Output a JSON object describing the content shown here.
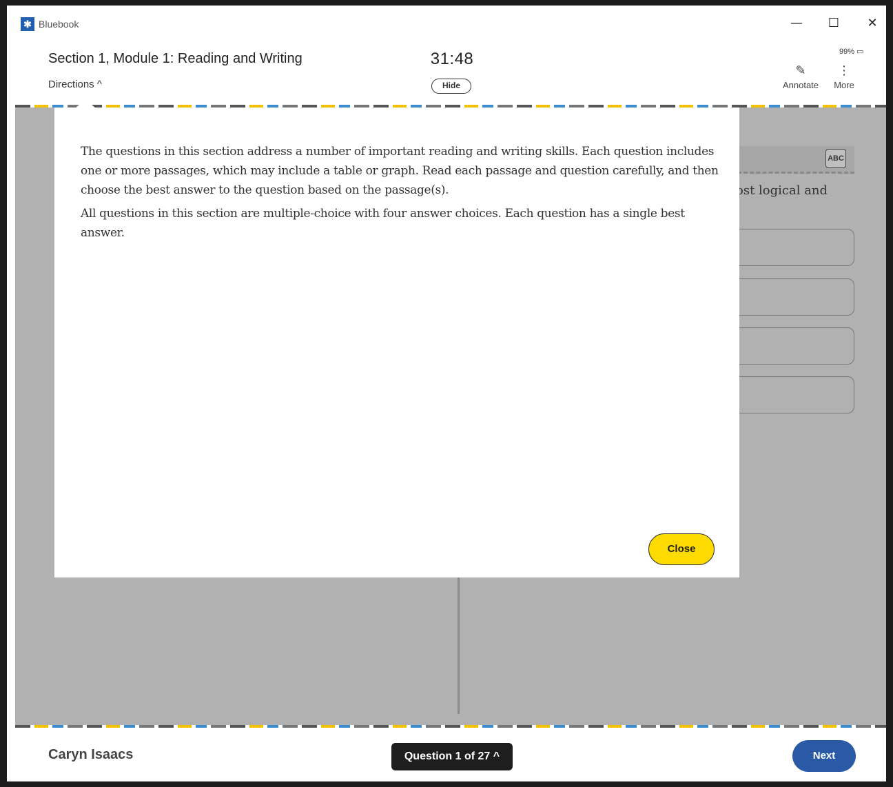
{
  "window": {
    "app_name": "Bluebook",
    "logo_glyph": "✱",
    "minimize_glyph": "—",
    "maximize_glyph": "☐",
    "close_glyph": "✕"
  },
  "header": {
    "section_title": "Section 1, Module 1: Reading and Writing",
    "directions_label": "Directions ^",
    "timer": "31:48",
    "hide_label": "Hide",
    "battery": "99% ▭",
    "annotate_label": "Annotate",
    "annotate_glyph": "✎",
    "more_label": "More",
    "more_glyph": "⋮"
  },
  "background_question": {
    "visible_text": "ost logical and",
    "mark_icon_label": "ABC"
  },
  "directions_modal": {
    "paragraphs": [
      "The questions in this section address a number of important reading and writing skills. Each question includes one or more passages, which may include a table or graph. Read each passage and question carefully, and then choose the best answer to the question based on the passage(s).",
      "All questions in this section are multiple-choice with four answer choices. Each question has a single best answer."
    ],
    "close_label": "Close"
  },
  "footer": {
    "student_name": "Caryn Isaacs",
    "question_nav_label": "Question 1 of 27 ^",
    "next_label": "Next"
  },
  "colors": {
    "accent_yellow": "#fedb00",
    "next_blue": "#2a5aa6",
    "overlay_gray": "#b1b1b1"
  }
}
